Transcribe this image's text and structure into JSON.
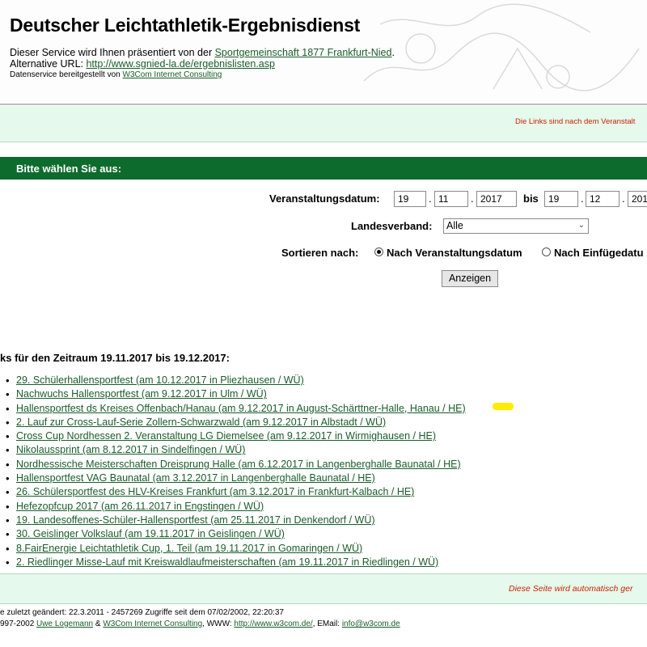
{
  "header": {
    "title": "Deutscher Leichtathletik-Ergebnisdienst",
    "service_prefix": "Dieser Service wird Ihnen präsentiert von der ",
    "service_link": "Sportgemeinschaft 1877 Frankfurt-Nied",
    "service_suffix": ".",
    "alt_prefix": "Alternative URL: ",
    "alt_link": "http://www.sgnied-la.de/ergebnislisten.asp",
    "data_prefix": "Datenservice bereitgestellt von ",
    "data_link": "W3Com Internet Consulting"
  },
  "notice": "Die Links sind nach dem Veranstalt",
  "form": {
    "heading": "Bitte wählen Sie aus:",
    "date_label": "Veranstaltungsdatum:",
    "from_day": "19",
    "from_month": "11",
    "from_year": "2017",
    "bis_label": "bis",
    "to_day": "19",
    "to_month": "12",
    "to_year": "201",
    "landes_label": "Landesverband:",
    "landes_value": "Alle",
    "sort_label": "Sortieren nach:",
    "sort_option_1": "Nach Veranstaltungsdatum",
    "sort_option_2": "Nach Einfügedatu",
    "submit": "Anzeigen"
  },
  "results": {
    "heading": "ks für den Zeitraum 19.11.2017 bis 19.12.2017:",
    "links": [
      "29. Schülerhallensportfest (am 10.12.2017 in Pliezhausen / WÜ)",
      "Nachwuchs Hallensportfest (am 9.12.2017 in Ulm / WÜ)",
      "Hallensportfest ds Kreises Offenbach/Hanau (am 9.12.2017 in August-Schärttner-Halle, Hanau / HE)",
      "2. Lauf zur Cross-Lauf-Serie Zollern-Schwarzwald (am 9.12.2017 in Albstadt / WÜ)",
      "Cross Cup Nordhessen 2. Veranstaltung LG Diemelsee (am 9.12.2017 in Wirmighausen / HE)",
      "Nikolaussprint (am 8.12.2017 in Sindelfingen / WÜ)",
      "Nordhessische Meisterschaften Dreisprung Halle (am 6.12.2017 in Langenberghalle Baunatal / HE)",
      "Hallensportfest VAG Baunatal (am 3.12.2017 in Langenberghalle Baunatal / HE)",
      "26. Schülersportfest des HLV-Kreises Frankfurt (am 3.12.2017 in Frankfurt-Kalbach / HE)",
      "Hefezopfcup 2017 (am 26.11.2017 in Engstingen / WÜ)",
      "19. Landesoffenes-Schüler-Hallensportfest (am 25.11.2017 in Denkendorf / WÜ)",
      "30. Geislinger Volkslauf (am 19.11.2017 in Geislingen / WÜ)",
      "8.FairEnergie Leichtathletik Cup, 1. Teil (am 19.11.2017 in Gomaringen / WÜ)",
      "2. Riedlinger Misse-Lauf mit Kreiswaldlaufmeisterschaften (am 19.11.2017 in Riedlingen / WÜ)"
    ]
  },
  "bottom_notice": "Diese Seite wird automatisch ger",
  "footer": {
    "line1": "e zuletzt geändert: 22.3.2011 - 2457269 Zugriffe seit dem 07/02/2002, 22:20:37",
    "line2_prefix": "997-2002 ",
    "author_link": "Uwe Logemann",
    "amp": " & ",
    "company_link": "W3Com Internet Consulting",
    "www_label": ", WWW: ",
    "www_link": "http://www.w3com.de/",
    "email_label": ", EMail: ",
    "email_link": "info@w3com.de"
  },
  "colors": {
    "brand_green": "#0e6b2e",
    "band_green": "#e5f9ec",
    "link_green": "#1a5c2a",
    "notice_red": "#cc2200"
  }
}
